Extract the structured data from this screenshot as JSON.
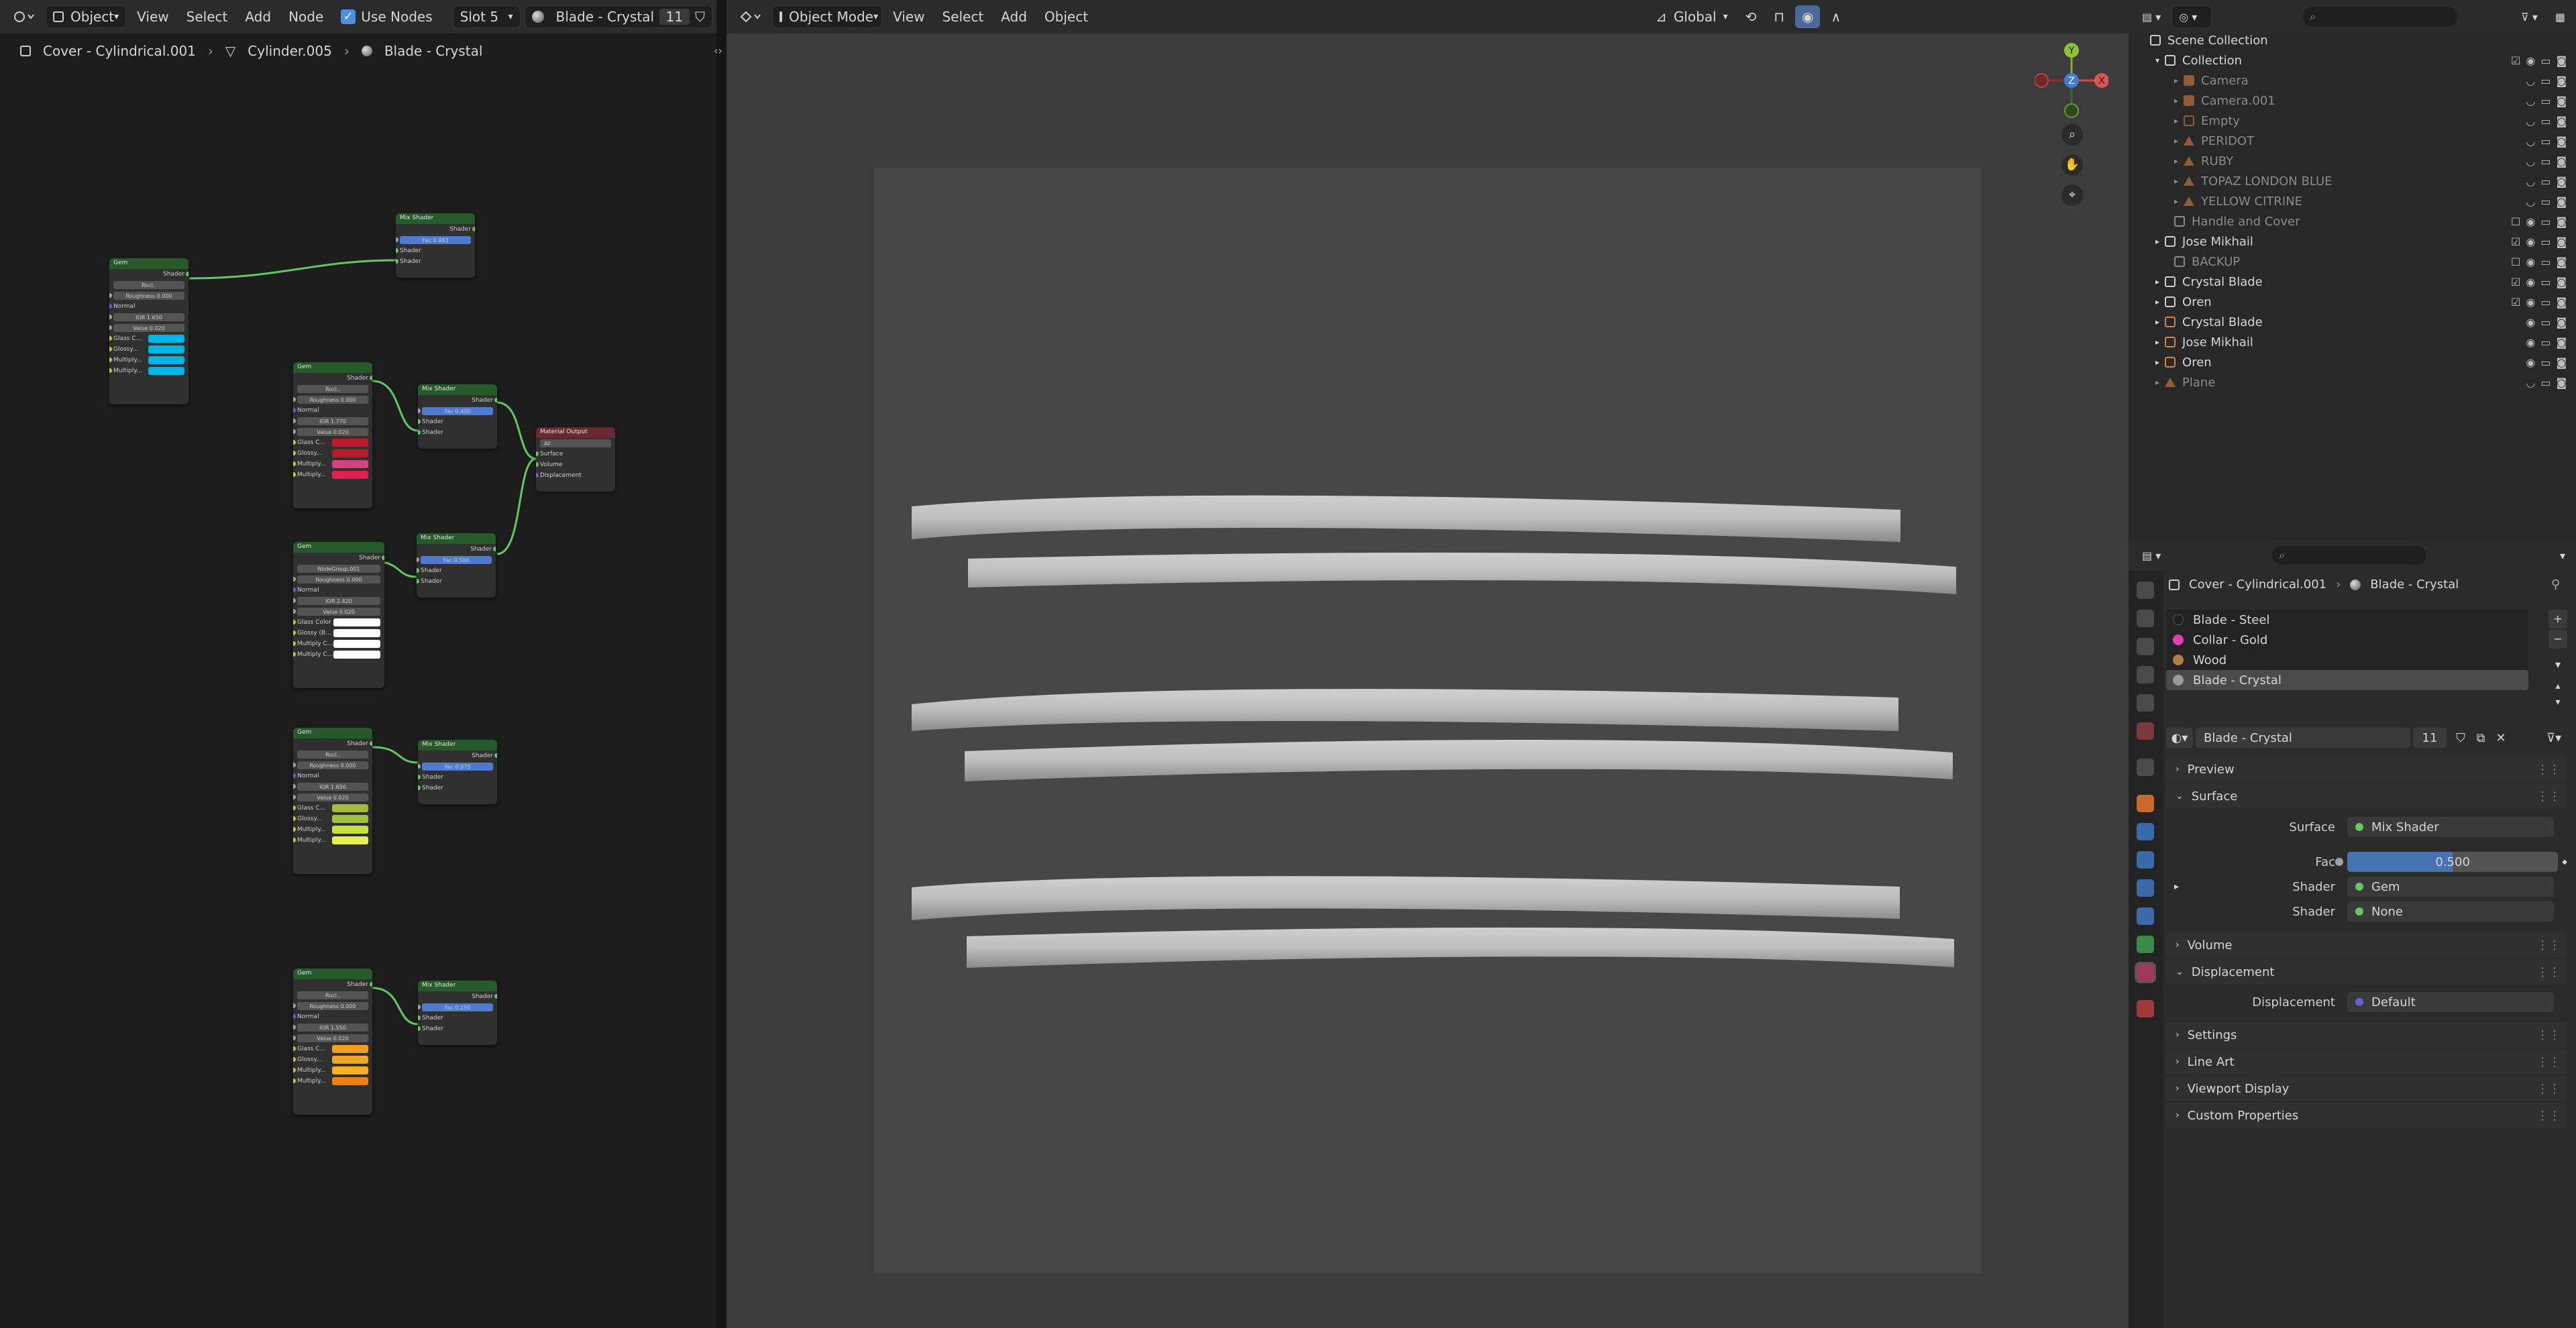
{
  "node_editor": {
    "header": {
      "object_menu": "Object",
      "menus": [
        "View",
        "Select",
        "Add",
        "Node"
      ],
      "use_nodes": "Use Nodes",
      "slot": "Slot 5",
      "material": "Blade - Crystal",
      "users": "11"
    },
    "breadcrumb": [
      "Cover - Cylindrical.001",
      "Cylinder.005",
      "Blade - Crystal"
    ],
    "gem_nodes": [
      {
        "title": "Gem",
        "group": "Rocl..",
        "roughness": "0.000",
        "ior": "1.650",
        "value": "0.020",
        "rows": [
          "Normal",
          "Glass C...",
          "Glossy...",
          "Multiply...",
          "Multiply..."
        ],
        "colors": [
          "#00b4ec",
          "#00b4ec",
          "#00b4ec",
          "#00b4ec"
        ]
      },
      {
        "title": "Gem",
        "group": "Rocl..",
        "roughness": "0.000",
        "ior": "1.770",
        "value": "0.020",
        "rows": [
          "Normal",
          "Glass C...",
          "Glossy...",
          "Multiply...",
          "Multiply..."
        ],
        "colors": [
          "#c0182c",
          "#b0202c",
          "#d84080",
          "#e02050"
        ]
      },
      {
        "title": "Gem",
        "group": "NodeGroup.001",
        "roughness": "0.000",
        "ior": "2.420",
        "value": "0.020",
        "rows": [
          "Normal",
          "Glass Color",
          "Glossy (B...",
          "Multiply C...",
          "Multiply C..."
        ],
        "colors": [
          "#ffffff",
          "#ffffff",
          "#ffffff",
          "#ffffff"
        ]
      },
      {
        "title": "Gem",
        "group": "Rocl..",
        "roughness": "0.000",
        "ior": "1.650",
        "value": "0.020",
        "rows": [
          "Normal",
          "Glass C...",
          "Glossy...",
          "Multiply...",
          "Multiply..."
        ],
        "colors": [
          "#a8b83c",
          "#a0c040",
          "#c8e040",
          "#e8f050"
        ]
      },
      {
        "title": "Gem",
        "group": "Rocl..",
        "roughness": "0.000",
        "ior": "1.550",
        "value": "0.020",
        "rows": [
          "Normal",
          "Glass C...",
          "Glossy...",
          "Multiply...",
          "Multiply..."
        ],
        "colors": [
          "#f0a020",
          "#f0a820",
          "#f8b020",
          "#f08010"
        ]
      }
    ],
    "mix_nodes": [
      {
        "title": "Mix Shader",
        "fac": "0.983"
      },
      {
        "title": "Mix Shader",
        "fac": "0.400"
      },
      {
        "title": "Mix Shader",
        "fac": "0.500"
      },
      {
        "title": "Mix Shader",
        "fac": "0.075"
      },
      {
        "title": "Mix Shader",
        "fac": "0.250"
      }
    ],
    "labels": {
      "shader": "Shader",
      "fac": "Fac",
      "roughness": "Roughness",
      "ior": "IOR",
      "value": "Value"
    },
    "output_node": {
      "title": "Material Output",
      "target": "All",
      "inputs": [
        "Surface",
        "Volume",
        "Displacement"
      ]
    }
  },
  "viewport": {
    "mode": "Object Mode",
    "menus": [
      "View",
      "Select",
      "Add",
      "Object"
    ],
    "orientation": "Global",
    "gizmo_axes": [
      "Y",
      "Z",
      "X"
    ]
  },
  "outliner": {
    "title": "Scene Collection",
    "items": [
      {
        "label": "Collection",
        "dim": false,
        "color": "#cfcfcf",
        "icon": "collection-icon"
      },
      {
        "label": "Camera",
        "dim": true,
        "color": "#d88040",
        "icon": "camera-icon"
      },
      {
        "label": "Camera.001",
        "dim": true,
        "color": "#d88040",
        "icon": "camera-icon"
      },
      {
        "label": "Empty",
        "dim": true,
        "color": "#d88040",
        "icon": "empty-icon"
      },
      {
        "label": "PERIDOT",
        "dim": true,
        "color": "#d88040",
        "icon": "mesh-icon"
      },
      {
        "label": "RUBY",
        "dim": true,
        "color": "#d88040",
        "icon": "mesh-icon"
      },
      {
        "label": "TOPAZ LONDON BLUE",
        "dim": true,
        "color": "#d88040",
        "icon": "mesh-icon"
      },
      {
        "label": "YELLOW CITRINE",
        "dim": true,
        "color": "#d88040",
        "icon": "mesh-icon"
      },
      {
        "label": "Handle and Cover",
        "dim": true,
        "color": "#cfcfcf",
        "icon": "collection-icon"
      },
      {
        "label": "Jose Mikhail",
        "dim": false,
        "color": "#cfcfcf",
        "icon": "collection-icon"
      },
      {
        "label": "BACKUP",
        "dim": true,
        "color": "#cfcfcf",
        "icon": "collection-icon"
      },
      {
        "label": "Crystal Blade",
        "dim": false,
        "color": "#cfcfcf",
        "icon": "collection-icon"
      },
      {
        "label": "Oren",
        "dim": false,
        "color": "#cfcfcf",
        "icon": "collection-icon"
      },
      {
        "label": "Crystal Blade",
        "dim": false,
        "color": "#d88040",
        "icon": "instance-icon"
      },
      {
        "label": "Jose Mikhail",
        "dim": false,
        "color": "#d88040",
        "icon": "instance-icon"
      },
      {
        "label": "Oren",
        "dim": false,
        "color": "#d88040",
        "icon": "instance-icon"
      },
      {
        "label": "Plane",
        "dim": true,
        "color": "#d88040",
        "icon": "mesh-icon"
      }
    ]
  },
  "properties": {
    "breadcrumb": [
      "Cover - Cylindrical.001",
      "Blade - Crystal"
    ],
    "slots": [
      {
        "label": "Blade - Steel",
        "color": "#202020"
      },
      {
        "label": "Collar - Gold",
        "color": "#e040b0"
      },
      {
        "label": "Wood",
        "color": "#b08040"
      },
      {
        "label": "Blade - Crystal",
        "color": "#9a9a9a"
      }
    ],
    "material_name": "Blade - Crystal",
    "material_users": "11",
    "panels": {
      "preview": "Preview",
      "surface": "Surface",
      "volume": "Volume",
      "displacement": "Displacement",
      "settings": "Settings",
      "line_art": "Line Art",
      "viewport_display": "Viewport Display",
      "custom_properties": "Custom Properties"
    },
    "surface": {
      "surface_label": "Surface",
      "surface_value": "Mix Shader",
      "fac_label": "Fac",
      "fac_value": "0.500",
      "fac_fraction": 0.5,
      "shader1_label": "Shader",
      "shader1_value": "Gem",
      "shader2_label": "Shader",
      "shader2_value": "None"
    },
    "displacement": {
      "label": "Displacement",
      "value": "Default"
    }
  }
}
